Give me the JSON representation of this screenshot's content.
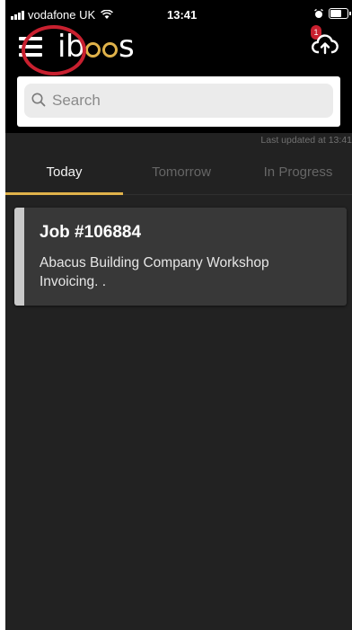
{
  "status_bar": {
    "carrier": "vodafone UK",
    "time": "13:41"
  },
  "header": {
    "logo_prefix": "ib",
    "logo_suffix": "s",
    "brand_accent": "#e0b24a",
    "highlight_color": "#c8202f",
    "notification_count": "1"
  },
  "search": {
    "placeholder": "Search",
    "value": ""
  },
  "last_updated": "Last updated at 13:41",
  "tabs": [
    {
      "label": "Today",
      "active": true
    },
    {
      "label": "Tomorrow",
      "active": false
    },
    {
      "label": "In Progress",
      "active": false
    }
  ],
  "jobs": [
    {
      "title": "Job #106884",
      "description": "Abacus Building Company Workshop Invoicing. ."
    }
  ],
  "icons": {
    "menu": "hamburger-menu-icon",
    "upload": "cloud-upload-icon",
    "search": "magnifier-icon",
    "alarm": "alarm-clock-icon",
    "battery": "battery-icon",
    "wifi": "wifi-icon",
    "signal": "cellular-signal-icon"
  }
}
